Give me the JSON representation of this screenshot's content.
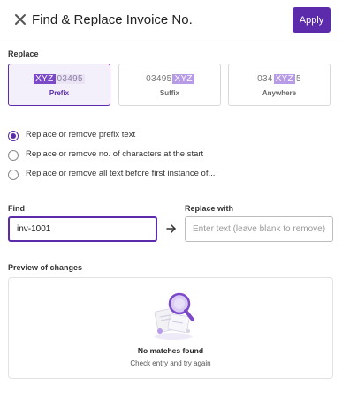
{
  "header": {
    "title": "Find & Replace Invoice No.",
    "apply_label": "Apply"
  },
  "replace_section": {
    "label": "Replace",
    "options": [
      {
        "label": "Prefix",
        "sample_parts": [
          "XYZ",
          "03495"
        ],
        "selected": true
      },
      {
        "label": "Suffix",
        "sample_parts": [
          "03495",
          "XYZ"
        ],
        "selected": false
      },
      {
        "label": "Anywhere",
        "sample_parts": [
          "034",
          "XYZ",
          "5"
        ],
        "selected": false
      }
    ]
  },
  "mode_options": [
    {
      "label": "Replace or remove prefix text",
      "checked": true
    },
    {
      "label": "Replace or remove no. of characters at the start",
      "checked": false
    },
    {
      "label": "Replace or remove all text before first instance of...",
      "checked": false
    }
  ],
  "find": {
    "label": "Find",
    "value": "inv-1001"
  },
  "replace_with": {
    "label": "Replace with",
    "placeholder": "Enter text (leave blank to remove)",
    "value": ""
  },
  "preview": {
    "label": "Preview of changes",
    "empty_title": "No matches found",
    "empty_subtitle": "Check entry and try again"
  },
  "colors": {
    "accent": "#5b2bab",
    "highlight": "#7c49c9"
  },
  "icons": {
    "close": "close-icon",
    "arrow": "arrow-right-icon",
    "illustration": "magnifier-documents-illustration"
  }
}
